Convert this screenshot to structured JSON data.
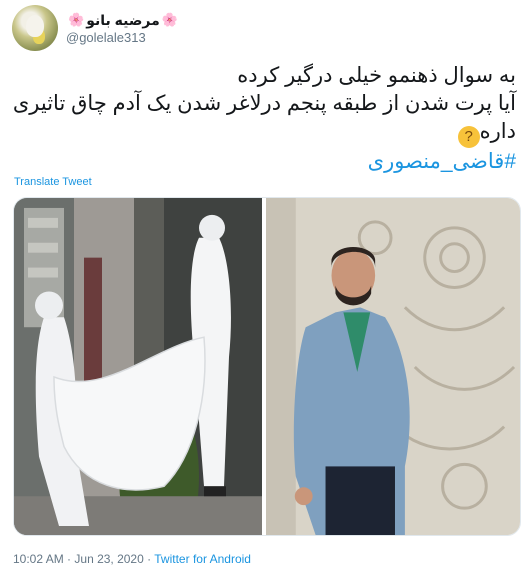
{
  "tweet": {
    "display_name": "مرضیه بانو",
    "name_emoji_left": "🌸",
    "name_emoji_right": "🌸",
    "handle": "@golelale313",
    "text_lines": [
      "به سوال ذهنمو خیلی درگیر کرده",
      "آیا پرت شدن از طبقه پنجم درلاغر شدن یک آدم چاق تاثیری",
      "داره"
    ],
    "emoji": "🤔",
    "hashtag": "#قاضی_منصوری",
    "translate_label": "Translate Tweet",
    "time": "10:02 AM",
    "separator": "·",
    "date": "Jun 23, 2020",
    "source": "Twitter for Android"
  },
  "media": {
    "left_photo": "workers-in-white-protective-suits-carrying-white-sheet",
    "right_photo": "man-in-blue-blazer-and-green-sweater-by-carved-wall"
  },
  "colors": {
    "link": "#1b95e0",
    "muted": "#657786",
    "text": "#14171a"
  }
}
